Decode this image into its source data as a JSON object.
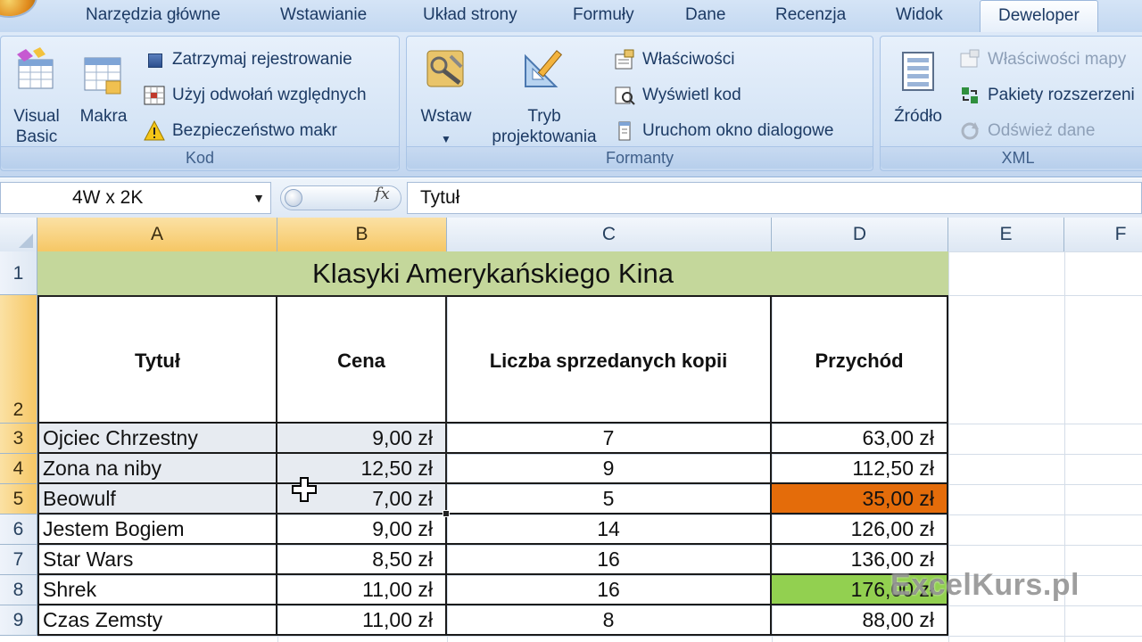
{
  "ribbon": {
    "tabs": [
      "Narzędzia główne",
      "Wstawianie",
      "Układ strony",
      "Formuły",
      "Dane",
      "Recenzja",
      "Widok",
      "Deweloper"
    ],
    "active_tab": "Deweloper",
    "groups": {
      "kod": {
        "label": "Kod",
        "visual_basic": [
          "Visual",
          "Basic"
        ],
        "macros": "Makra",
        "stop_recording": "Zatrzymaj rejestrowanie",
        "relative_refs": "Użyj odwołań względnych",
        "macro_security": "Bezpieczeństwo makr"
      },
      "formanty": {
        "label": "Formanty",
        "insert": "Wstaw",
        "design_mode": [
          "Tryb",
          "projektowania"
        ],
        "properties": "Właściwości",
        "view_code": "Wyświetl kod",
        "run_dialog": "Uruchom okno dialogowe"
      },
      "xml": {
        "label": "XML",
        "source": "Źródło",
        "map_properties": "Właściwości mapy",
        "expansion_packs": "Pakiety rozszerzeni",
        "refresh_data": "Odśwież dane"
      }
    }
  },
  "formula_bar": {
    "name_box": "4W x 2K",
    "fx": "fx",
    "content": "Tytuł"
  },
  "sheet": {
    "columns": [
      "A",
      "B",
      "C",
      "D",
      "E",
      "F"
    ],
    "selected_columns": [
      "A",
      "B"
    ],
    "rows": [
      "1",
      "2",
      "3",
      "4",
      "5",
      "6",
      "7",
      "8",
      "9"
    ],
    "selected_rows": [
      "2",
      "3",
      "4",
      "5"
    ],
    "title": "Klasyki Amerykańskiego Kina",
    "headers": [
      "Tytuł",
      "Cena",
      "Liczba sprzedanych kopii",
      "Przychód"
    ],
    "data": [
      {
        "title": "Ojciec Chrzestny",
        "price": "9,00 zł",
        "copies": "7",
        "revenue": "63,00 zł"
      },
      {
        "title": "Zona na niby",
        "price": "12,50 zł",
        "copies": "9",
        "revenue": "112,50 zł"
      },
      {
        "title": "Beowulf",
        "price": "7,00 zł",
        "copies": "5",
        "revenue": "35,00 zł",
        "revenue_fill": "#e46c0a"
      },
      {
        "title": "Jestem Bogiem",
        "price": "9,00 zł",
        "copies": "14",
        "revenue": "126,00 zł"
      },
      {
        "title": "Star Wars",
        "price": "8,50 zł",
        "copies": "16",
        "revenue": "136,00 zł"
      },
      {
        "title": "Shrek",
        "price": "11,00 zł",
        "copies": "16",
        "revenue": "176,00 zł",
        "revenue_fill": "#92d050"
      },
      {
        "title": "Czas Zemsty",
        "price": "11,00 zł",
        "copies": "8",
        "revenue": "88,00 zł"
      }
    ],
    "title_fill": "#c4d79b"
  },
  "watermark": "ExcelKurs.pl",
  "icons": [
    "visual-basic-icon",
    "macros-icon",
    "stop-recording-icon",
    "relative-refs-icon",
    "warning-icon",
    "insert-control-icon",
    "design-mode-icon",
    "properties-icon",
    "view-code-icon",
    "run-dialog-icon",
    "xml-source-icon",
    "map-properties-icon",
    "expansion-packs-icon",
    "refresh-data-icon",
    "fx-icon",
    "move-cursor-icon"
  ]
}
